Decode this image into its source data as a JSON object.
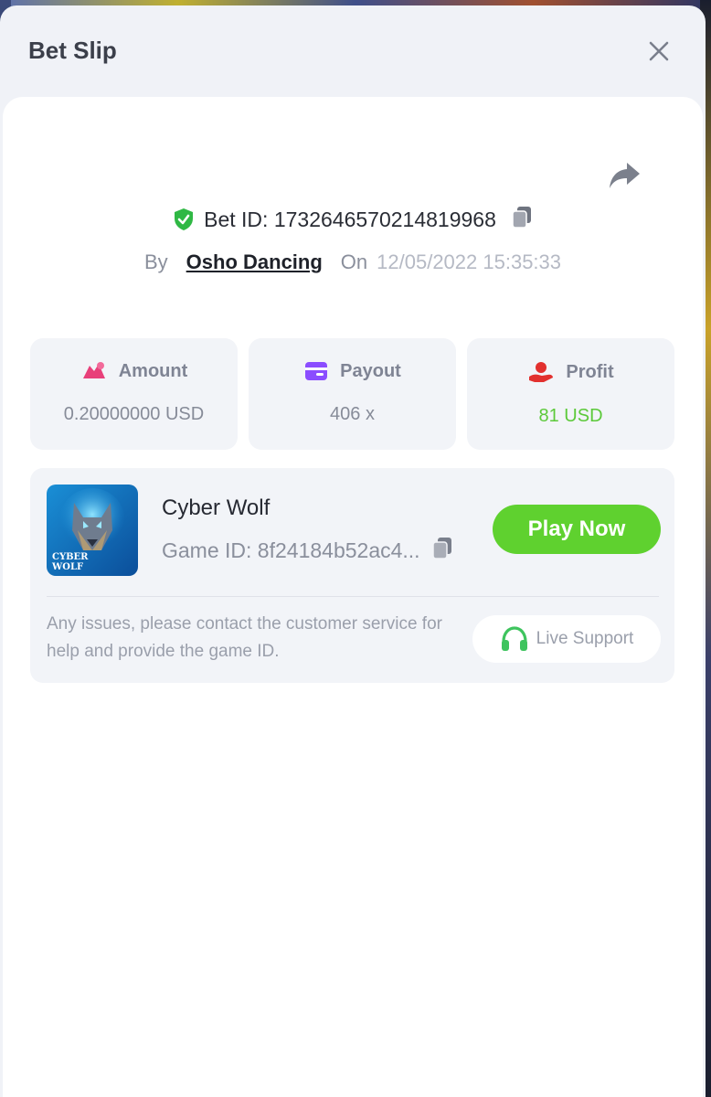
{
  "modal": {
    "title": "Bet Slip"
  },
  "bet": {
    "id_label": "Bet ID: 1732646570214819968",
    "by_label": "By",
    "user": "Osho Dancing",
    "on_label": "On",
    "date": "12/05/2022 15:35:33"
  },
  "stats": {
    "amount": {
      "label": "Amount",
      "value": "0.20000000 USD"
    },
    "payout": {
      "label": "Payout",
      "value": "406 x"
    },
    "profit": {
      "label": "Profit",
      "value": "81 USD"
    }
  },
  "game": {
    "name": "Cyber Wolf",
    "id_label": "Game ID: 8f24184b52ac4...",
    "thumb_text": "CYBER WOLF",
    "play_label": "Play Now"
  },
  "help": {
    "text": "Any issues, please contact the customer service for help and provide the game ID.",
    "support_label": "Live Support"
  },
  "colors": {
    "accent_green": "#5fd12f",
    "profit_green": "#5cc93a",
    "amount_icon": "#e8407a",
    "payout_icon": "#8b4dff",
    "profit_icon": "#e2302e"
  }
}
